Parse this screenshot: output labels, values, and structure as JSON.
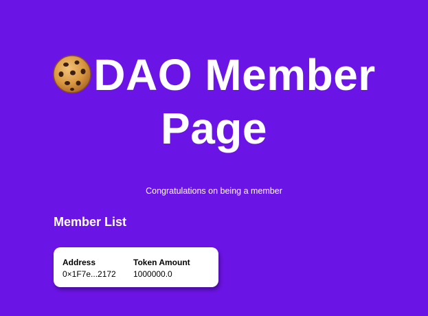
{
  "header": {
    "title": "DAO Member Page",
    "title_icon": "cookie-icon"
  },
  "subtitle": "Congratulations on being a member",
  "member_list": {
    "heading": "Member List",
    "columns": [
      "Address",
      "Token Amount"
    ],
    "rows": [
      {
        "address": "0×1F7e...2172",
        "token_amount": "1000000.0"
      }
    ]
  },
  "colors": {
    "background": "#6b14e6",
    "card": "#ffffff",
    "text": "#ffffff"
  }
}
